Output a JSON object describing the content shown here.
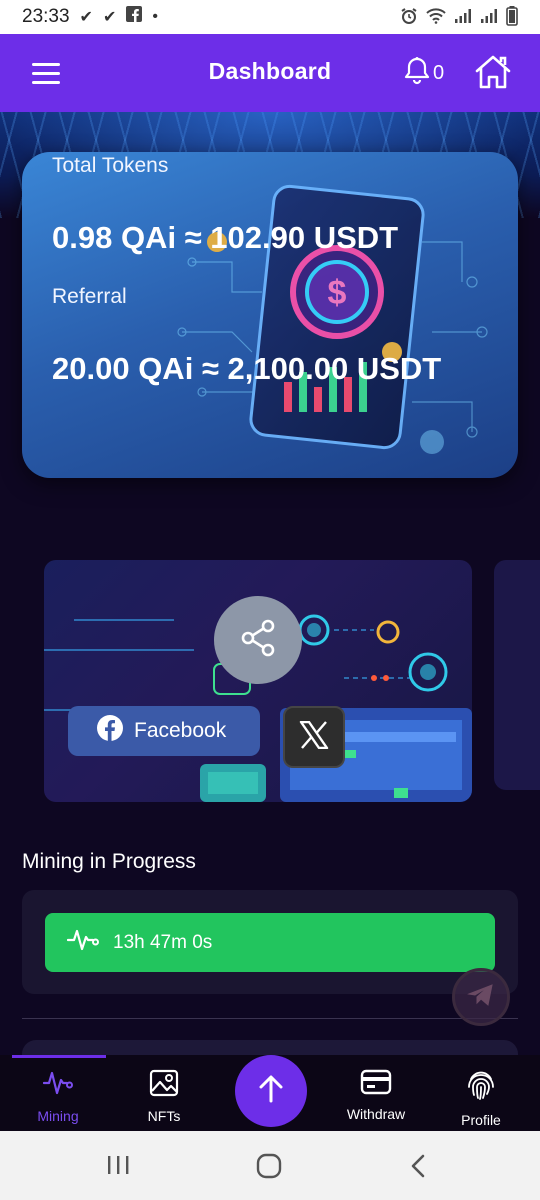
{
  "status_bar": {
    "time": "23:33",
    "notification_icons": [
      "check-icon",
      "check-icon",
      "facebook-icon",
      "dot-icon"
    ],
    "system_icons": [
      "alarm-icon",
      "wifi-icon",
      "signal-icon",
      "signal-icon",
      "battery-icon"
    ]
  },
  "app_bar": {
    "title": "Dashboard",
    "notification_count": "0",
    "color": "#6d2ee8"
  },
  "token_card": {
    "total_label": "Total Tokens",
    "total_value": "0.98 QAi ≈ 102.90 USDT",
    "referral_label": "Referral",
    "referral_value": "20.00 QAi ≈ 2,100.00 USDT"
  },
  "share": {
    "facebook_label": "Facebook",
    "x_icon": "x-logo-icon"
  },
  "mining": {
    "title": "Mining in Progress",
    "timer": "13h 47m 0s",
    "color": "#22c55e"
  },
  "bottom_nav": {
    "items": [
      {
        "label": "Mining",
        "icon": "pulse-icon",
        "active": true
      },
      {
        "label": "NFTs",
        "icon": "image-icon",
        "active": false
      },
      {
        "label": "Withdraw",
        "icon": "card-icon",
        "active": false
      },
      {
        "label": "Profile",
        "icon": "fingerprint-icon",
        "active": false
      }
    ]
  }
}
